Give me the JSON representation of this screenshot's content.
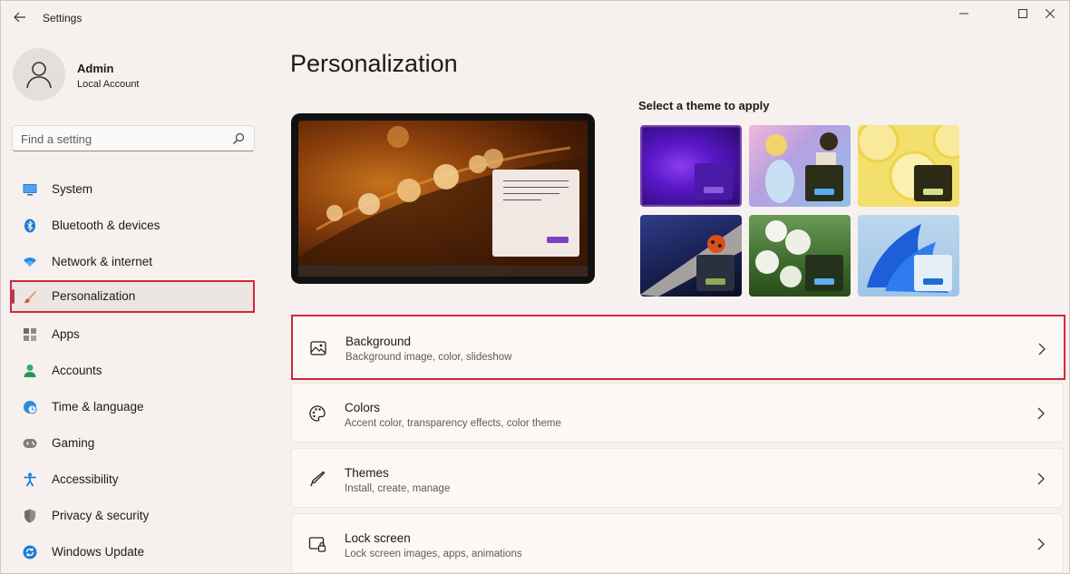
{
  "window": {
    "title": "Settings"
  },
  "account": {
    "name": "Admin",
    "type": "Local Account"
  },
  "search": {
    "placeholder": "Find a setting"
  },
  "nav": {
    "items": [
      {
        "label": "System",
        "icon": "monitor-icon"
      },
      {
        "label": "Bluetooth & devices",
        "icon": "bluetooth-icon"
      },
      {
        "label": "Network & internet",
        "icon": "wifi-icon"
      },
      {
        "label": "Personalization",
        "icon": "brush-icon",
        "selected": true
      },
      {
        "label": "Apps",
        "icon": "apps-icon"
      },
      {
        "label": "Accounts",
        "icon": "person-icon"
      },
      {
        "label": "Time & language",
        "icon": "globe-clock-icon"
      },
      {
        "label": "Gaming",
        "icon": "gamepad-icon"
      },
      {
        "label": "Accessibility",
        "icon": "accessibility-icon"
      },
      {
        "label": "Privacy & security",
        "icon": "shield-icon"
      },
      {
        "label": "Windows Update",
        "icon": "update-icon"
      }
    ]
  },
  "main": {
    "title": "Personalization",
    "themes_label": "Select a theme to apply",
    "rows": [
      {
        "title": "Background",
        "subtitle": "Background image, color, slideshow",
        "icon": "image-icon"
      },
      {
        "title": "Colors",
        "subtitle": "Accent color, transparency effects, color theme",
        "icon": "palette-icon"
      },
      {
        "title": "Themes",
        "subtitle": "Install, create, manage",
        "icon": "pen-icon"
      },
      {
        "title": "Lock screen",
        "subtitle": "Lock screen images, apps, animations",
        "icon": "lock-screen-icon"
      }
    ]
  },
  "colors": {
    "accent": "#7b3fc4",
    "highlight": "#d3263a"
  }
}
